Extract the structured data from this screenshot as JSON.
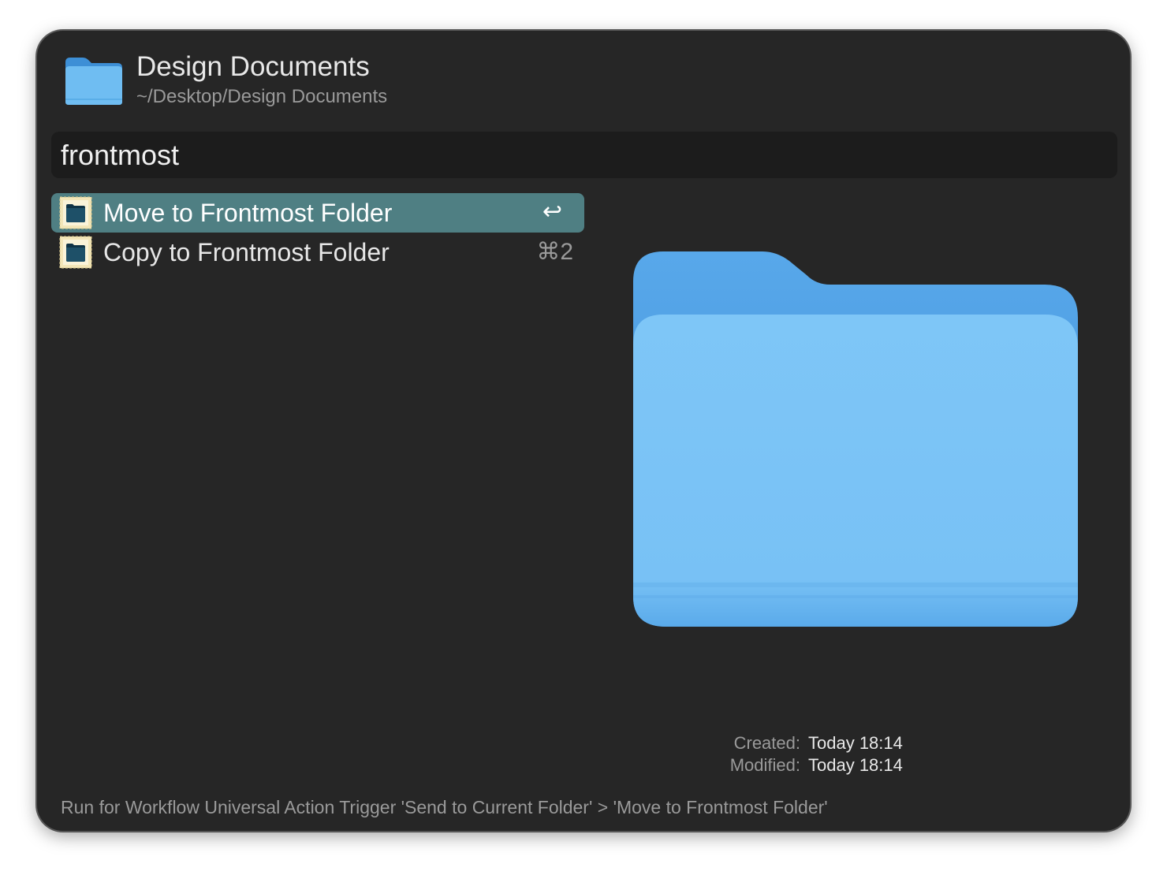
{
  "header": {
    "title": "Design Documents",
    "path": "~/Desktop/Design Documents",
    "icon": "folder-icon"
  },
  "search": {
    "value": "frontmost"
  },
  "results": [
    {
      "label": "Move to Frontmost Folder",
      "shortcut": "↩",
      "selected": true,
      "icon": "workflow-stamp-folder-icon"
    },
    {
      "label": "Copy to Frontmost Folder",
      "shortcut": "⌘2",
      "selected": false,
      "icon": "workflow-stamp-folder-icon"
    }
  ],
  "preview": {
    "icon": "large-folder-icon",
    "created_label": "Created:",
    "created_value": "Today 18:14",
    "modified_label": "Modified:",
    "modified_value": "Today 18:14"
  },
  "footer": {
    "text": "Run for Workflow Universal Action Trigger 'Send to Current Folder' > 'Move to Frontmost Folder'"
  },
  "colors": {
    "window_bg": "#262626",
    "search_bg": "#1c1c1c",
    "selection": "#4f7f83",
    "folder_blue": "#7cc4f5"
  }
}
